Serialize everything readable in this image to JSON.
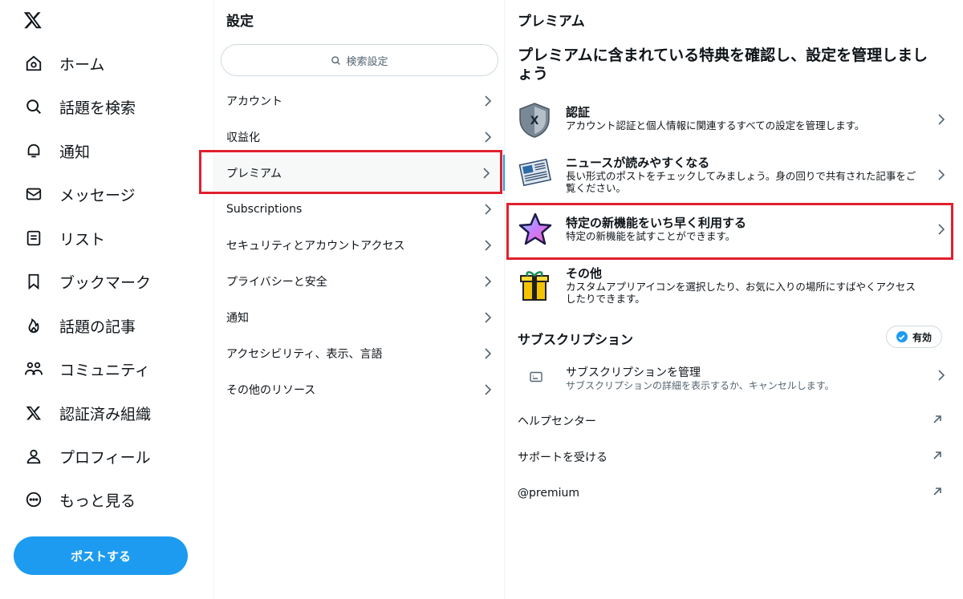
{
  "nav": {
    "logo": "X",
    "items": [
      {
        "label": "ホーム",
        "icon": "home-icon"
      },
      {
        "label": "話題を検索",
        "icon": "search-icon"
      },
      {
        "label": "通知",
        "icon": "bell-icon"
      },
      {
        "label": "メッセージ",
        "icon": "mail-icon"
      },
      {
        "label": "リスト",
        "icon": "list-icon"
      },
      {
        "label": "ブックマーク",
        "icon": "bookmark-icon"
      },
      {
        "label": "話題の記事",
        "icon": "flame-icon"
      },
      {
        "label": "コミュニティ",
        "icon": "people-icon"
      },
      {
        "label": "認証済み組織",
        "icon": "x-logo-icon"
      },
      {
        "label": "プロフィール",
        "icon": "person-icon"
      },
      {
        "label": "もっと見る",
        "icon": "more-circle-icon"
      }
    ],
    "post_label": "ポストする"
  },
  "settings": {
    "title": "設定",
    "search_placeholder": "検索設定",
    "items": [
      {
        "label": "アカウント"
      },
      {
        "label": "収益化"
      },
      {
        "label": "プレミアム",
        "active": true
      },
      {
        "label": "Subscriptions"
      },
      {
        "label": "セキュリティとアカウントアクセス"
      },
      {
        "label": "プライバシーと安全"
      },
      {
        "label": "通知"
      },
      {
        "label": "アクセシビリティ、表示、言語"
      },
      {
        "label": "その他のリソース"
      }
    ]
  },
  "premium": {
    "title": "プレミアム",
    "subheading": "プレミアムに含まれている特典を確認し、設定を管理しましょう",
    "features": [
      {
        "title": "認証",
        "desc": "アカウント認証と個人情報に関連するすべての設定を管理します。",
        "icon": "shield-icon"
      },
      {
        "title": "ニュースが読みやすくなる",
        "desc": "長い形式のポストをチェックしてみましょう。身の回りで共有された記事をご覧ください。",
        "icon": "newspaper-icon"
      },
      {
        "title": "特定の新機能をいち早く利用する",
        "desc": "特定の新機能を試すことができます。",
        "icon": "star-icon"
      },
      {
        "title": "その他",
        "desc": "カスタムアプリアイコンを選択したり、お気に入りの場所にすばやくアクセスしたりできます。",
        "icon": "gift-icon"
      }
    ],
    "subscription_title": "サブスクリプション",
    "badge_label": "有効",
    "manage_title": "サブスクリプションを管理",
    "manage_desc": "サブスクリプションの詳細を表示するか、キャンセルします。",
    "links": [
      {
        "label": "ヘルプセンター"
      },
      {
        "label": "サポートを受ける"
      },
      {
        "label": "@premium"
      }
    ]
  },
  "colors": {
    "accent": "#1d9bf0",
    "highlight": "#e0202e",
    "text": "#0f1419",
    "muted": "#536471"
  }
}
